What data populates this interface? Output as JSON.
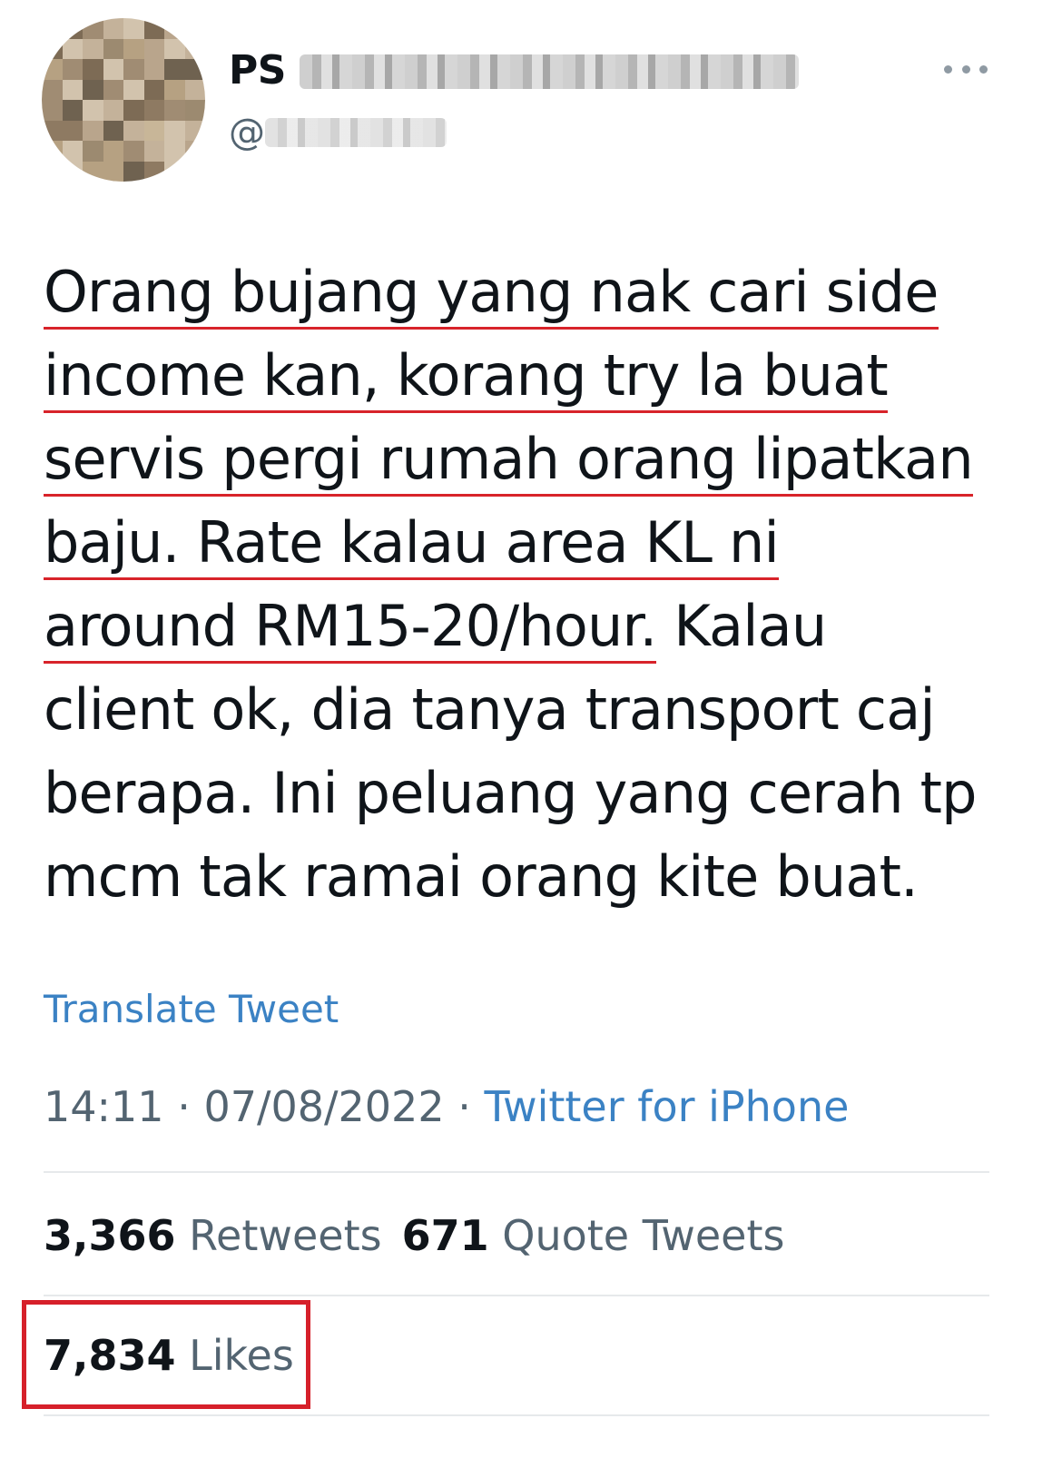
{
  "tweet": {
    "display_name": "PS",
    "handle_prefix": "@",
    "text_lines": [
      {
        "text": "Orang bujang yang nak cari side",
        "underlined": true
      },
      {
        "text": "income kan, korang try la buat",
        "underlined": true
      },
      {
        "text": "servis pergi rumah orang lipatkan",
        "underlined": true
      },
      {
        "text": "baju. Rate kalau area KL ni",
        "underlined": true
      },
      {
        "underlined_part": "around RM15-20/hour.",
        "rest": " Kalau"
      },
      {
        "text": "client ok, dia tanya transport caj",
        "underlined": false
      },
      {
        "text": "berapa. Ini peluang yang cerah tp",
        "underlined": false
      },
      {
        "text": "mcm tak ramai orang kite buat.",
        "underlined": false
      }
    ],
    "translate_label": "Translate Tweet",
    "time": "14:11",
    "separator": " · ",
    "date": "07/08/2022",
    "source": "Twitter for iPhone"
  },
  "stats": {
    "retweets_count": "3,366",
    "retweets_label": "Retweets",
    "quotes_count": "671",
    "quotes_label": "Quote Tweets",
    "likes_count": "7,834",
    "likes_label": "Likes"
  },
  "icons": {
    "more": "more-horizontal-icon"
  },
  "colors": {
    "link": "#3b82c4",
    "secondary_text": "#536471",
    "highlight_red": "#d6202a"
  }
}
